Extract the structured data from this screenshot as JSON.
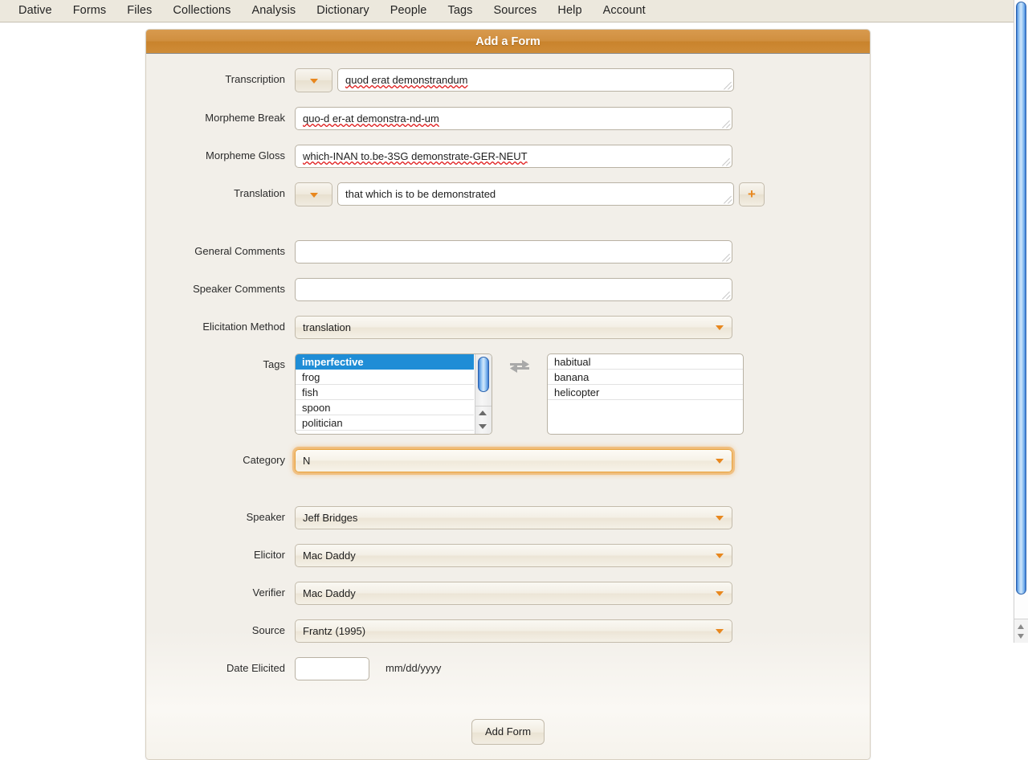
{
  "menubar": {
    "items": [
      {
        "label": "Dative"
      },
      {
        "label": "Forms"
      },
      {
        "label": "Files"
      },
      {
        "label": "Collections"
      },
      {
        "label": "Analysis"
      },
      {
        "label": "Dictionary"
      },
      {
        "label": "People"
      },
      {
        "label": "Tags"
      },
      {
        "label": "Sources"
      },
      {
        "label": "Help"
      },
      {
        "label": "Account"
      }
    ]
  },
  "panel": {
    "title": "Add a Form",
    "accent_color": "#d08f3f",
    "focus_color": "#e8a33d",
    "select_highlight_color": "#1f8dd6"
  },
  "fields": {
    "transcription": {
      "label": "Transcription",
      "value": "quod erat demonstrandum",
      "has_dropdown": true,
      "dropdown_icon": "caret-down-icon"
    },
    "morpheme_break": {
      "label": "Morpheme Break",
      "value": "quo-d er-at demonstra-nd-um"
    },
    "morpheme_gloss": {
      "label": "Morpheme Gloss",
      "value": "which-INAN to.be-3SG demonstrate-GER-NEUT"
    },
    "translation": {
      "label": "Translation",
      "value": "that which is to be demonstrated",
      "has_dropdown": true,
      "add_button_label": "+"
    },
    "general_comments": {
      "label": "General Comments",
      "value": ""
    },
    "speaker_comments": {
      "label": "Speaker Comments",
      "value": ""
    },
    "elicitation_method": {
      "label": "Elicitation Method",
      "value": "translation"
    },
    "tags": {
      "label": "Tags",
      "available": [
        {
          "label": "imperfective",
          "selected": true
        },
        {
          "label": "frog",
          "selected": false
        },
        {
          "label": "fish",
          "selected": false
        },
        {
          "label": "spoon",
          "selected": false
        },
        {
          "label": "politician",
          "selected": false
        }
      ],
      "chosen": [
        "habitual",
        "banana",
        "helicopter"
      ],
      "swap_icon": "exchange-arrows-icon"
    },
    "category": {
      "label": "Category",
      "value": "N",
      "focused": true
    },
    "speaker": {
      "label": "Speaker",
      "value": "Jeff Bridges"
    },
    "elicitor": {
      "label": "Elicitor",
      "value": "Mac Daddy"
    },
    "verifier": {
      "label": "Verifier",
      "value": "Mac Daddy"
    },
    "source": {
      "label": "Source",
      "value": "Frantz (1995)"
    },
    "date_elicited": {
      "label": "Date Elicited",
      "value": "",
      "format_hint": "mm/dd/yyyy"
    }
  },
  "footer": {
    "submit_label": "Add Form"
  }
}
